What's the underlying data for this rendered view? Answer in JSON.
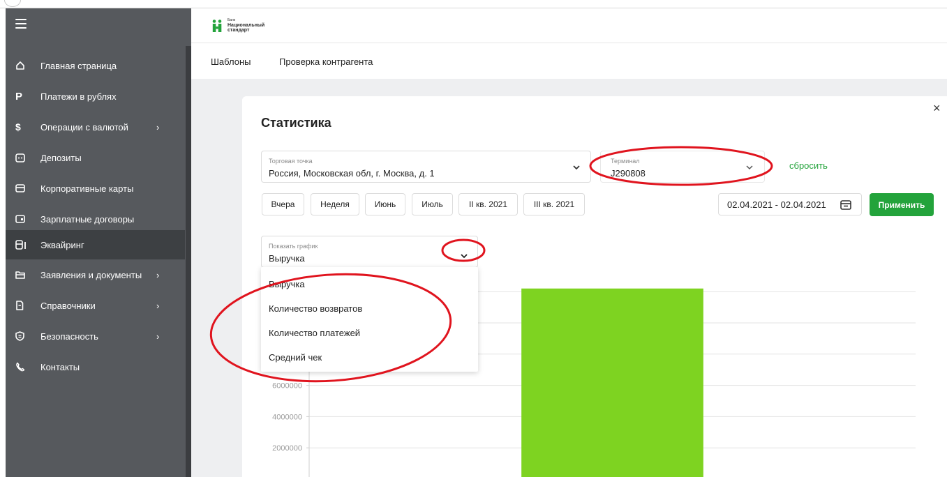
{
  "sidebar": {
    "items": [
      {
        "label": "Главная страница",
        "icon": "home-icon",
        "has_submenu": false,
        "active": false
      },
      {
        "label": "Платежи в рублях",
        "icon": "ruble-icon",
        "has_submenu": false,
        "active": false
      },
      {
        "label": "Операции с валютой",
        "icon": "dollar-icon",
        "has_submenu": true,
        "active": false
      },
      {
        "label": "Депозиты",
        "icon": "deposit-icon",
        "has_submenu": false,
        "active": false
      },
      {
        "label": "Корпоративные карты",
        "icon": "card-icon",
        "has_submenu": false,
        "active": false
      },
      {
        "label": "Зарплатные договоры",
        "icon": "salary-icon",
        "has_submenu": false,
        "active": false
      },
      {
        "label": "Эквайринг",
        "icon": "acquiring-icon",
        "has_submenu": false,
        "active": true
      },
      {
        "label": "Заявления и документы",
        "icon": "folder-icon",
        "has_submenu": true,
        "active": false
      },
      {
        "label": "Справочники",
        "icon": "directory-icon",
        "has_submenu": true,
        "active": false
      },
      {
        "label": "Безопасность",
        "icon": "shield-icon",
        "has_submenu": true,
        "active": false
      },
      {
        "label": "Контакты",
        "icon": "phone-icon",
        "has_submenu": false,
        "active": false
      }
    ],
    "chevron": "›"
  },
  "header": {
    "logo_small": "Банк",
    "logo_line1": "Национальный",
    "logo_line2": "стандарт"
  },
  "subnav": {
    "tabs": [
      {
        "label": "Шаблоны"
      },
      {
        "label": "Проверка контрагента"
      }
    ]
  },
  "modal": {
    "title": "Статистика",
    "close": "×",
    "point_field": {
      "label": "Торговая точка",
      "value": "Россия, Московская обл, г. Москва, д. 1"
    },
    "terminal_field": {
      "label": "Терминал",
      "value": "J290808"
    },
    "reset_label": "сбросить",
    "periods": [
      "Вчера",
      "Неделя",
      "Июнь",
      "Июль",
      "II кв. 2021",
      "III кв. 2021"
    ],
    "date_range": "02.04.2021 - 02.04.2021",
    "apply_label": "Применить",
    "chart_select": {
      "label": "Показать график",
      "value": "Выручка",
      "options": [
        "Выручка",
        "Количество возвратов",
        "Количество платежей",
        "Средний чек"
      ]
    }
  },
  "colors": {
    "sidebar_bg": "#56595d",
    "sidebar_active": "#3d4043",
    "accent_green": "#23a33b",
    "bar_green": "#7ed321",
    "annotation_red": "#e0141e"
  },
  "chart_data": {
    "type": "bar",
    "categories": [
      ""
    ],
    "values": [
      12200000
    ],
    "ytick_labels": [
      "2000000",
      "4000000",
      "6000000"
    ],
    "ylim": [
      0,
      14000000
    ],
    "grid": true,
    "title": "",
    "xlabel": "",
    "ylabel": ""
  }
}
